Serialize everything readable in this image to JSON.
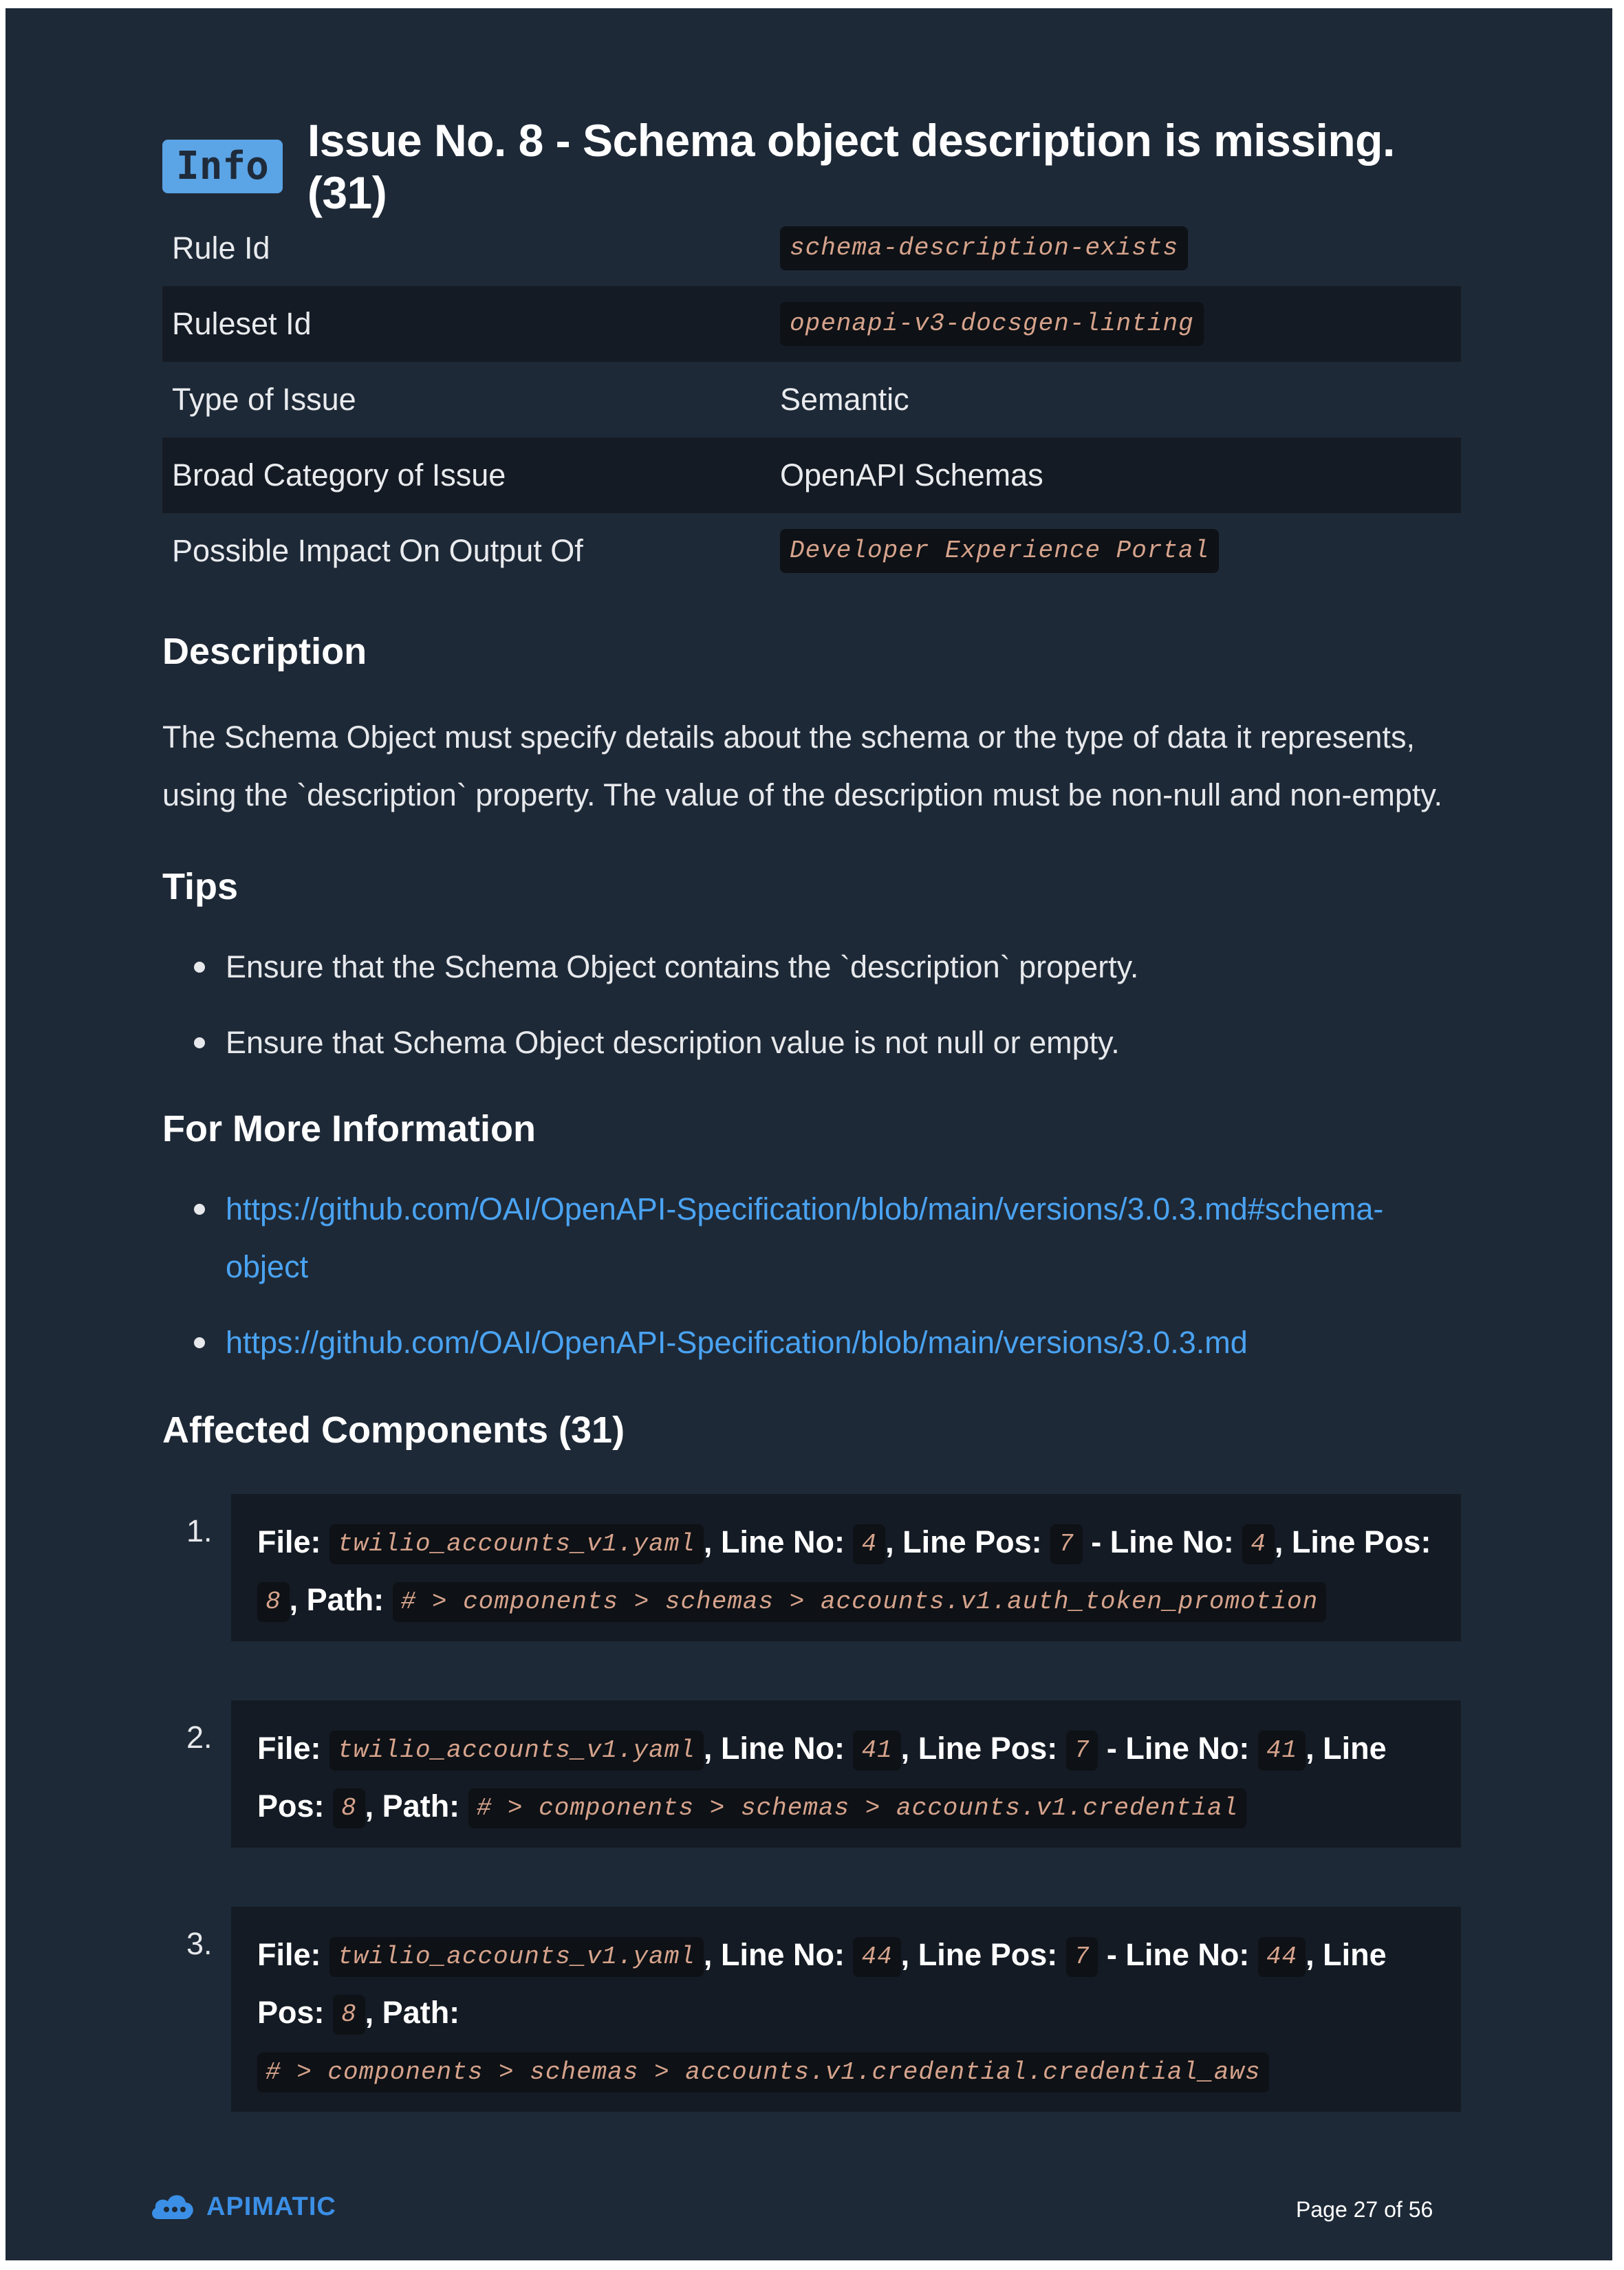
{
  "header": {
    "badge": "Info",
    "title": "Issue No. 8 - Schema object description is missing. (31)"
  },
  "info_table": {
    "rows": [
      {
        "key": "Rule Id",
        "value": "schema-description-exists",
        "code": true
      },
      {
        "key": "Ruleset Id",
        "value": "openapi-v3-docsgen-linting",
        "code": true
      },
      {
        "key": "Type of Issue",
        "value": "Semantic",
        "code": false
      },
      {
        "key": "Broad Category of Issue",
        "value": "OpenAPI Schemas",
        "code": false
      },
      {
        "key": "Possible Impact On Output Of",
        "value": "Developer Experience Portal",
        "code": true
      }
    ]
  },
  "description": {
    "heading": "Description",
    "text": "The Schema Object must specify details about the schema or the type of data it represents, using the `description` property. The value of the description must be non-null and non-empty."
  },
  "tips": {
    "heading": "Tips",
    "items": [
      "Ensure that the Schema Object contains the `description` property.",
      "Ensure that Schema Object description value is not null or empty."
    ]
  },
  "more_info": {
    "heading": "For More Information",
    "links": [
      "https://github.com/OAI/OpenAPI-Specification/blob/main/versions/3.0.3.md#schema-object",
      "https://github.com/OAI/OpenAPI-Specification/blob/main/versions/3.0.3.md"
    ]
  },
  "affected": {
    "heading": "Affected Components (31)",
    "labels": {
      "file": "File:",
      "line_no": "Line No:",
      "line_pos": "Line Pos:",
      "path": "Path:",
      "comma": ",",
      "dash": "-"
    },
    "items": [
      {
        "num": "1.",
        "file": "twilio_accounts_v1.yaml",
        "start_line": "4",
        "start_pos": "7",
        "end_line": "4",
        "end_pos": "8",
        "path": "# > components > schemas > accounts.v1.auth_token_promotion"
      },
      {
        "num": "2.",
        "file": "twilio_accounts_v1.yaml",
        "start_line": "41",
        "start_pos": "7",
        "end_line": "41",
        "end_pos": "8",
        "path": "# > components > schemas > accounts.v1.credential"
      },
      {
        "num": "3.",
        "file": "twilio_accounts_v1.yaml",
        "start_line": "44",
        "start_pos": "7",
        "end_line": "44",
        "end_pos": "8",
        "path": "# > components > schemas > accounts.v1.credential.credential_aws"
      }
    ]
  },
  "footer": {
    "brand": "APIMATIC",
    "page": "Page 27 of 56"
  },
  "colors": {
    "page_bg": "#1e2937",
    "badge_bg": "#5ba4e6",
    "link": "#4aa3f2",
    "code_text": "#d6a38c",
    "code_bg": "#0e1115",
    "brand": "#3b8fe6"
  }
}
